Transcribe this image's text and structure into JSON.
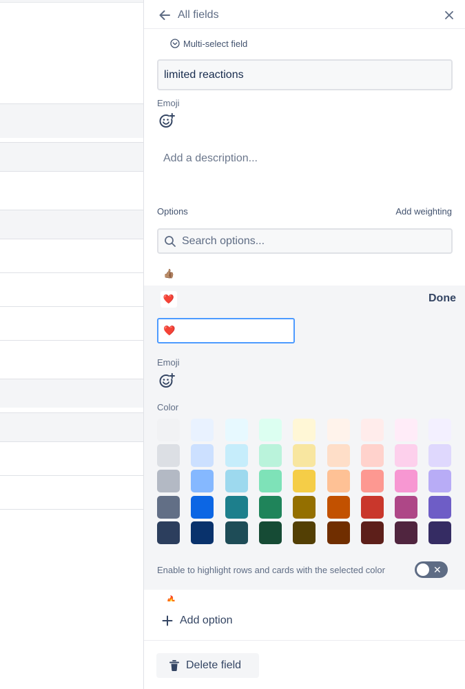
{
  "header": {
    "title": "All fields"
  },
  "field": {
    "type_label": "Multi-select field",
    "name_value": "limited reactions",
    "emoji_label": "Emoji",
    "description_placeholder": "Add a description..."
  },
  "options": {
    "label": "Options",
    "add_weighting": "Add weighting",
    "search_placeholder": "Search options...",
    "items": [
      {
        "emoji": "👍🏽"
      },
      {
        "emoji": "❤️"
      }
    ]
  },
  "edit_option": {
    "chip_emoji": "❤️",
    "done_label": "Done",
    "input_value": "❤️",
    "emoji_label": "Emoji",
    "color_label": "Color",
    "highlight_label": "Enable to highlight rows and cards with the selected color",
    "highlight_enabled": false,
    "color_palette": [
      [
        "#f1f2f4",
        "#e9f2ff",
        "#e7f9ff",
        "#dcfff1",
        "#fff7d6",
        "#fff3eb",
        "#ffeceb",
        "#ffecf8",
        "#f3f0ff"
      ],
      [
        "#dcdfe4",
        "#cce0ff",
        "#c6edfb",
        "#baf3db",
        "#f8e6a0",
        "#fedec8",
        "#ffd2cc",
        "#fdd0ec",
        "#dfd8fd"
      ],
      [
        "#b3b9c4",
        "#85b8ff",
        "#9dd9ee",
        "#7ee2b8",
        "#f5cd47",
        "#fec195",
        "#fd9891",
        "#f797d2",
        "#b8acf6"
      ],
      [
        "#626f86",
        "#0c66e4",
        "#1d7f8c",
        "#1f845a",
        "#946f00",
        "#c25100",
        "#c9372c",
        "#ae4787",
        "#6e5dc6"
      ],
      [
        "#2c3e5d",
        "#09326c",
        "#1e4c57",
        "#164b35",
        "#533f04",
        "#702e00",
        "#5d1f1a",
        "#50253f",
        "#352c63"
      ]
    ]
  },
  "next_option": {
    "emoji": "🔥"
  },
  "footer": {
    "add_option_label": "Add option",
    "delete_label": "Delete field"
  },
  "colors": {
    "accent": "#4c9aff",
    "text_primary": "#172b4d",
    "text_muted": "#5e6c84"
  }
}
